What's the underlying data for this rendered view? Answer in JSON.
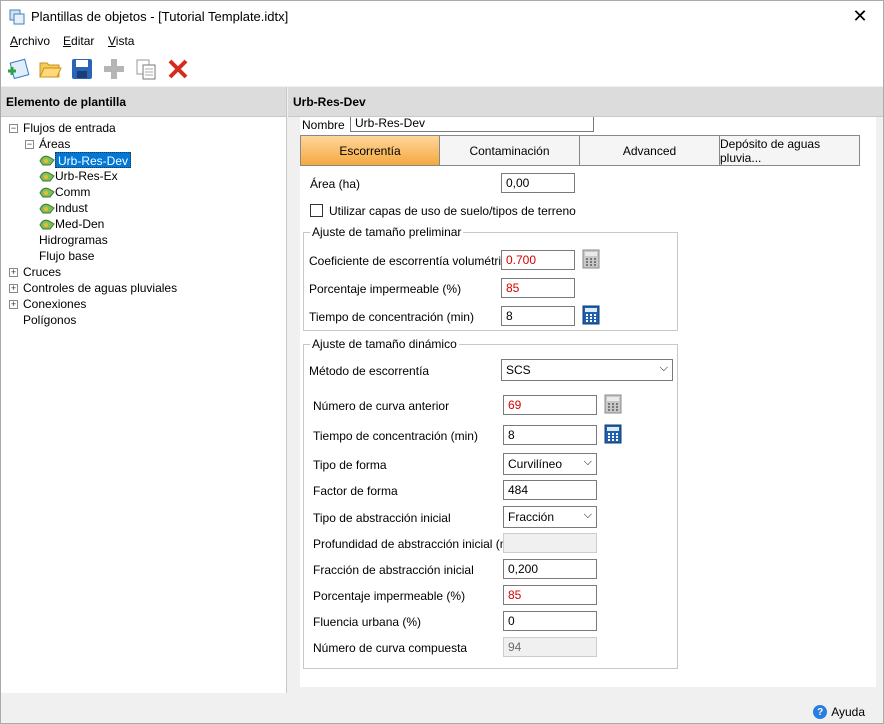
{
  "window": {
    "title": "Plantillas de objetos - [Tutorial Template.idtx]",
    "close_glyph": "✕"
  },
  "menu": {
    "file": {
      "accel": "A",
      "rest": "rchivo"
    },
    "edit": {
      "accel": "E",
      "rest": "ditar"
    },
    "view": {
      "accel": "V",
      "rest": "ista"
    }
  },
  "toolbar": {
    "icons": [
      "add-icon",
      "open-folder-icon",
      "save-icon",
      "plus-icon",
      "copy-icon",
      "delete-icon"
    ]
  },
  "tree": {
    "header": "Elemento de plantilla",
    "nodes": {
      "flujos": "Flujos de entrada",
      "areas": "Áreas",
      "urb_res_dev": "Urb-Res-Dev",
      "urb_res_ex": "Urb-Res-Ex",
      "comm": "Comm",
      "indust": "Indust",
      "med_den": "Med-Den",
      "hidrogramas": "Hidrogramas",
      "flujo_base": "Flujo base",
      "cruces": "Cruces",
      "controles": "Controles de aguas pluviales",
      "conexiones": "Conexiones",
      "poligonos": "Polígonos"
    },
    "expand_plus": "+",
    "expand_minus": "−"
  },
  "detail": {
    "header": "Urb-Res-Dev",
    "nombre_label": "Nombre",
    "nombre_value": "Urb-Res-Dev",
    "tabs": [
      "Escorrentía",
      "Contaminación",
      "Advanced",
      "Depósito de aguas pluvia..."
    ],
    "active_tab": 0,
    "area_label": "Área (ha)",
    "area_value": "0,00",
    "checkbox_label": "Utilizar capas de uso de suelo/tipos de terreno",
    "group_prelim": {
      "title": "Ajuste de tamaño preliminar",
      "coef_label": "Coeficiente de escorrentía volumétrica",
      "coef_value": "0.700",
      "imperm_label": "Porcentaje impermeable (%)",
      "imperm_value": "85",
      "tc_label": "Tiempo de concentración (min)",
      "tc_value": "8"
    },
    "group_dyn": {
      "title": "Ajuste de tamaño dinámico",
      "metodo_label": "Método de escorrentía",
      "metodo_value": "SCS",
      "cn_label": "Número de curva anterior",
      "cn_value": "69",
      "tc_label": "Tiempo de concentración (min)",
      "tc_value": "8",
      "forma_label": "Tipo de forma",
      "forma_value": "Curvilíneo",
      "factor_label": "Factor de forma",
      "factor_value": "484",
      "abs_tipo_label": "Tipo de abstracción inicial",
      "abs_tipo_value": "Fracción",
      "abs_prof_label": "Profundidad de abstracción inicial (mm)",
      "abs_prof_value": "",
      "abs_frac_label": "Fracción de abstracción inicial",
      "abs_frac_value": "0,200",
      "imperm_label": "Porcentaje impermeable (%)",
      "imperm_value": "85",
      "fluencia_label": "Fluencia urbana (%)",
      "fluencia_value": "0",
      "cn_comp_label": "Número de curva compuesta",
      "cn_comp_value": "94"
    },
    "chevron": "⌵"
  },
  "status": {
    "help_label": "Ayuda",
    "help_glyph": "?"
  },
  "colors": {
    "accent": "#0078d7",
    "active_tab": "#f4a940",
    "error_text": "#d80000"
  }
}
